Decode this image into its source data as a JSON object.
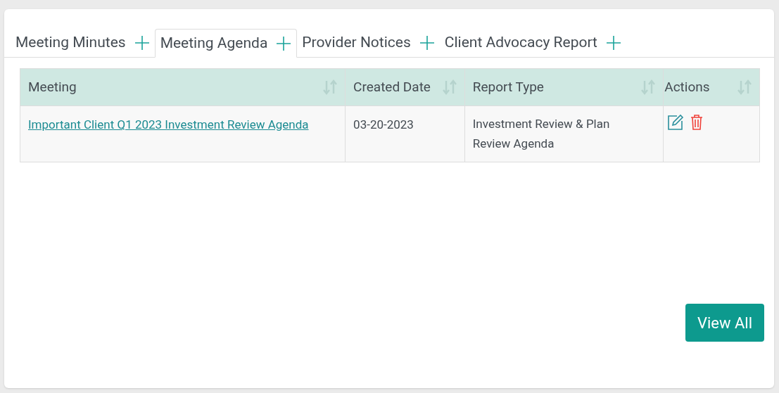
{
  "tabs": [
    {
      "label": "Meeting Minutes",
      "selected": false
    },
    {
      "label": "Meeting Agenda",
      "selected": true
    },
    {
      "label": "Provider Notices",
      "selected": false
    },
    {
      "label": "Client Advocacy Report",
      "selected": false
    }
  ],
  "table": {
    "columns": [
      "Meeting",
      "Created Date",
      "Report Type",
      "Actions"
    ],
    "rows": [
      {
        "meeting": "Important Client Q1 2023 Investment Review Agenda",
        "created_date": "03-20-2023",
        "report_type": "Investment Review & Plan Review Agenda"
      }
    ]
  },
  "view_all_button": "View All"
}
